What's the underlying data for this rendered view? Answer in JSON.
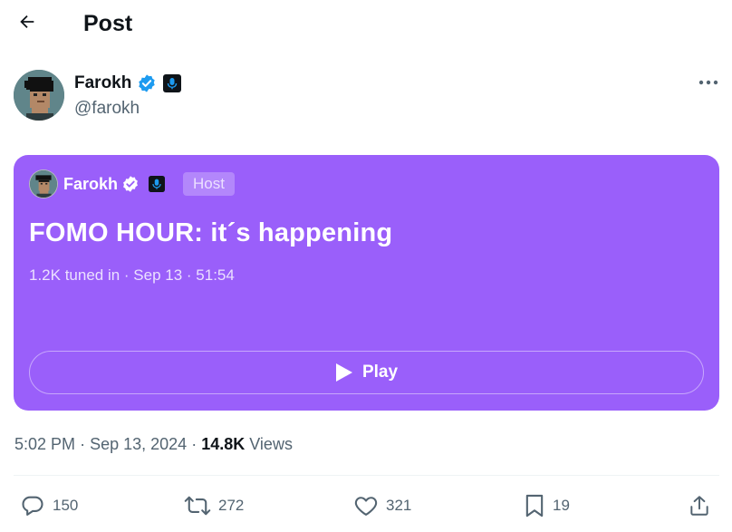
{
  "header": {
    "title": "Post"
  },
  "author": {
    "name": "Farokh",
    "handle": "@farokh"
  },
  "space": {
    "host_name": "Farokh",
    "host_pill": "Host",
    "title": "FOMO HOUR: it´s happening",
    "meta": "1.2K tuned in · Sep 13 · 51:54",
    "play_label": "Play",
    "card_color": "#9a5ffa"
  },
  "post_meta": {
    "time": "5:02 PM",
    "date": "Sep 13, 2024",
    "views_count": "14.8K",
    "views_label": "Views"
  },
  "actions": {
    "replies": "150",
    "reposts": "272",
    "likes": "321",
    "bookmarks": "19"
  },
  "colors": {
    "verified": "#1d9bf0",
    "muted_text": "#536471"
  },
  "icons": [
    "back-arrow-icon",
    "verified-badge-icon",
    "microphone-badge-icon",
    "more-icon",
    "play-icon",
    "reply-icon",
    "repost-icon",
    "like-icon",
    "bookmark-icon",
    "share-icon"
  ]
}
